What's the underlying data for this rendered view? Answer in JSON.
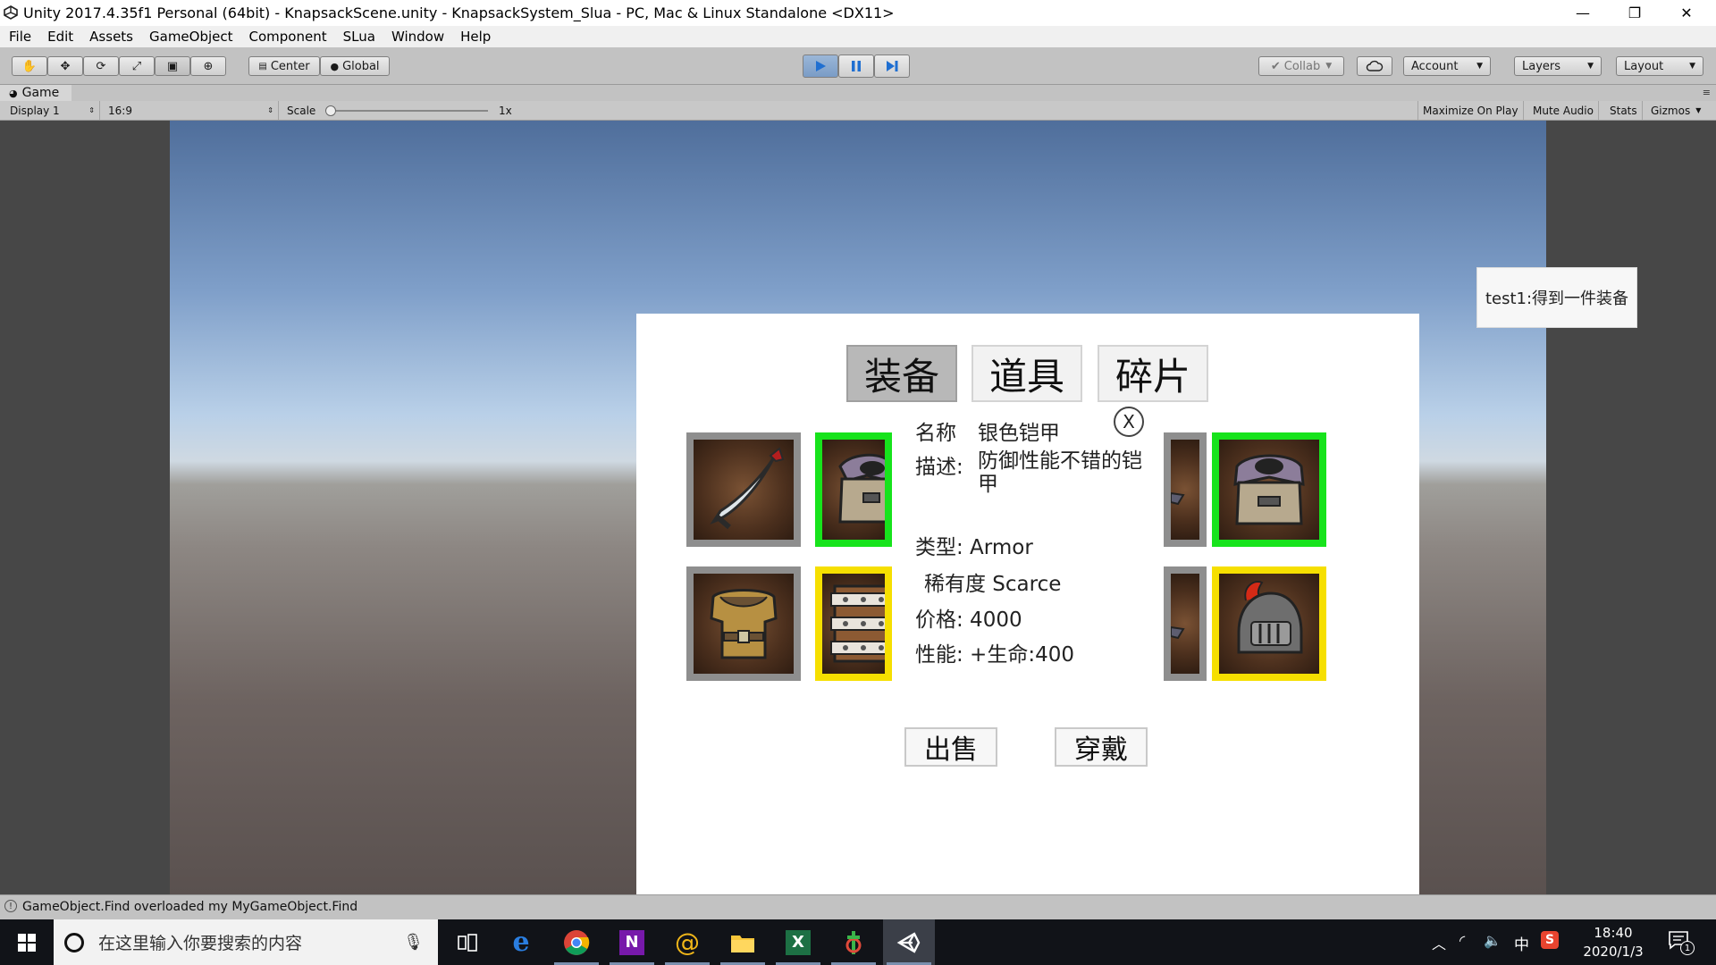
{
  "window": {
    "title": "Unity 2017.4.35f1 Personal (64bit) - KnapsackScene.unity - KnapsackSystem_Slua - PC, Mac & Linux Standalone <DX11>",
    "min_glyph": "—",
    "restore_glyph": "❐",
    "close_glyph": "✕"
  },
  "menu": [
    "File",
    "Edit",
    "Assets",
    "GameObject",
    "Component",
    "SLua",
    "Window",
    "Help"
  ],
  "toolbar": {
    "pivot_center": "Center",
    "pivot_global": "Global",
    "collab": "Collab",
    "account": "Account",
    "layers": "Layers",
    "layout": "Layout",
    "tool_icons": [
      "hand-icon",
      "move-icon",
      "rotate-icon",
      "scale-icon",
      "rect-icon",
      "transform-icon"
    ],
    "play_color": "#3d8fe3"
  },
  "game_view": {
    "tab_label": "Game",
    "display": "Display 1",
    "aspect": "16:9",
    "scale_label": "Scale",
    "scale_value": "1x",
    "maximize": "Maximize On Play",
    "mute": "Mute Audio",
    "stats": "Stats",
    "gizmos": "Gizmos"
  },
  "knapsack": {
    "tabs": [
      "装备",
      "道具",
      "碎片"
    ],
    "active_tab": "装备",
    "slots_row1": [
      {
        "item": "dagger-icon",
        "rarity": "normal"
      },
      {
        "item": "armor-icon",
        "rarity": "green"
      },
      {
        "item": "armor-icon",
        "rarity": "normal"
      },
      {
        "item": "armor-icon",
        "rarity": "green"
      }
    ],
    "slots_row2": [
      {
        "item": "leather-armor-icon",
        "rarity": "normal"
      },
      {
        "item": "belt-icon",
        "rarity": "yellow"
      },
      {
        "item": "armor-icon",
        "rarity": "normal"
      },
      {
        "item": "helmet-icon",
        "rarity": "yellow"
      }
    ],
    "detail": {
      "close": "X",
      "name_label": "名称",
      "name_value": "银色铠甲",
      "desc_label": "描述:",
      "desc_value": "防御性能不错的铠甲",
      "type_line": "类型: Armor",
      "rarity_line": "稀有度  Scarce",
      "price_line": "价格: 4000",
      "perf_line": "性能:  +生命:400"
    },
    "sell": "出售",
    "equip": "穿戴",
    "toast": "test1:得到一件装备"
  },
  "status": {
    "message": "GameObject.Find overloaded my MyGameObject.Find"
  },
  "taskbar": {
    "search_placeholder": "在这里输入你要搜索的内容",
    "time": "18:40",
    "date": "2020/1/3",
    "ime": "中",
    "notif_count": "1",
    "apps": [
      "task-view-icon",
      "edge-icon",
      "chrome-icon",
      "onenote-icon",
      "app-swirl-icon",
      "file-explorer-icon",
      "excel-icon",
      "git-icon",
      "unity-icon"
    ]
  }
}
